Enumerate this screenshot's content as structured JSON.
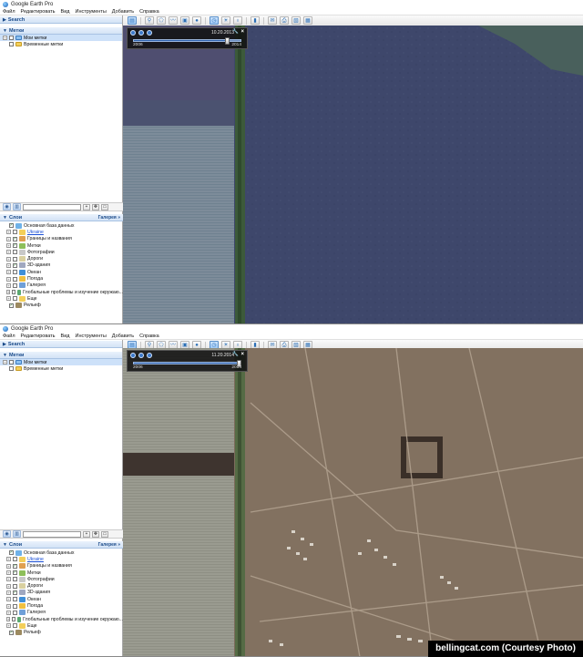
{
  "credit": "bellingcat.com (Courtesy Photo)",
  "colors": {
    "panel_header_text": "#1b4b8a",
    "map_top_imagery": "#3f4a6e",
    "map_bottom_imagery": "#7d6c5d",
    "tree_line": "#3c5a3a",
    "slider_track": "#2f62ad"
  },
  "screenshots": [
    {
      "app_title": "Google Earth Pro",
      "menu": [
        "Файл",
        "Редактировать",
        "Вид",
        "Инструменты",
        "Добавить",
        "Справка"
      ],
      "toolbar_icons": [
        "sidebar-icon",
        "placemark-icon",
        "polygon-icon",
        "path-icon",
        "image-overlay-icon",
        "record-tour-icon",
        "historical-imagery-icon",
        "sun-icon",
        "planets-icon",
        "ruler-icon",
        "email-icon",
        "print-icon",
        "save-image-icon",
        "view-in-maps-icon"
      ],
      "search_label": "Search",
      "places_label": "Метки",
      "places": [
        {
          "label": "Мои метки",
          "selected": true
        },
        {
          "label": "Временные метки",
          "selected": false
        }
      ],
      "layers_label": "Слои",
      "gallery_label": "Галерея",
      "layers": [
        {
          "label": "Основная база данных",
          "checked": true,
          "icon": "globe-icon",
          "link": false
        },
        {
          "label": "Ukraine",
          "checked": false,
          "icon": "folder-icon",
          "link": true
        },
        {
          "label": "Границы и названия",
          "checked": true,
          "icon": "borders-icon",
          "link": false
        },
        {
          "label": "Метки",
          "checked": true,
          "icon": "placemarks-icon",
          "link": false
        },
        {
          "label": "Фотографии",
          "checked": false,
          "icon": "photos-icon",
          "link": false
        },
        {
          "label": "Дороги",
          "checked": false,
          "icon": "roads-icon",
          "link": false
        },
        {
          "label": "3D-здания",
          "checked": true,
          "icon": "buildings-3d-icon",
          "link": false
        },
        {
          "label": "Океан",
          "checked": false,
          "icon": "ocean-icon",
          "link": false
        },
        {
          "label": "Погода",
          "checked": false,
          "icon": "weather-icon",
          "link": false
        },
        {
          "label": "Галерея",
          "checked": false,
          "icon": "gallery-icon",
          "link": false
        },
        {
          "label": "Глобальные проблемы и изучение окружаю...",
          "checked": false,
          "icon": "global-awareness-icon",
          "link": false
        },
        {
          "label": "Еще",
          "checked": false,
          "icon": "more-icon",
          "link": false
        },
        {
          "label": "Рельеф",
          "checked": true,
          "icon": "terrain-icon",
          "link": false
        }
      ],
      "slider": {
        "date": "10.20.2013",
        "start": "2006",
        "end": "2014",
        "position": 0.875
      }
    },
    {
      "app_title": "Google Earth Pro",
      "menu": [
        "Файл",
        "Редактировать",
        "Вид",
        "Инструменты",
        "Добавить",
        "Справка"
      ],
      "toolbar_icons": [
        "sidebar-icon",
        "placemark-icon",
        "polygon-icon",
        "path-icon",
        "image-overlay-icon",
        "record-tour-icon",
        "historical-imagery-icon",
        "sun-icon",
        "planets-icon",
        "ruler-icon",
        "email-icon",
        "print-icon",
        "save-image-icon",
        "view-in-maps-icon"
      ],
      "search_label": "Search",
      "places_label": "Метки",
      "places": [
        {
          "label": "Мои метки",
          "selected": true
        },
        {
          "label": "Временные метки",
          "selected": false
        }
      ],
      "layers_label": "Слои",
      "gallery_label": "Галерея",
      "layers": [
        {
          "label": "Основная база данных",
          "checked": true,
          "icon": "globe-icon",
          "link": false
        },
        {
          "label": "Ukraine",
          "checked": false,
          "icon": "folder-icon",
          "link": true
        },
        {
          "label": "Границы и названия",
          "checked": true,
          "icon": "borders-icon",
          "link": false
        },
        {
          "label": "Метки",
          "checked": true,
          "icon": "placemarks-icon",
          "link": false
        },
        {
          "label": "Фотографии",
          "checked": false,
          "icon": "photos-icon",
          "link": false
        },
        {
          "label": "Дороги",
          "checked": false,
          "icon": "roads-icon",
          "link": false
        },
        {
          "label": "3D-здания",
          "checked": true,
          "icon": "buildings-3d-icon",
          "link": false
        },
        {
          "label": "Океан",
          "checked": false,
          "icon": "ocean-icon",
          "link": false
        },
        {
          "label": "Погода",
          "checked": false,
          "icon": "weather-icon",
          "link": false
        },
        {
          "label": "Галерея",
          "checked": false,
          "icon": "gallery-icon",
          "link": false
        },
        {
          "label": "Глобальные проблемы и изучение окружаю...",
          "checked": false,
          "icon": "global-awareness-icon",
          "link": false
        },
        {
          "label": "Еще",
          "checked": false,
          "icon": "more-icon",
          "link": false
        },
        {
          "label": "Рельеф",
          "checked": true,
          "icon": "terrain-icon",
          "link": false
        }
      ],
      "slider": {
        "date": "11.20.2014",
        "start": "2006",
        "end": "2014",
        "position": 0.98
      }
    }
  ]
}
